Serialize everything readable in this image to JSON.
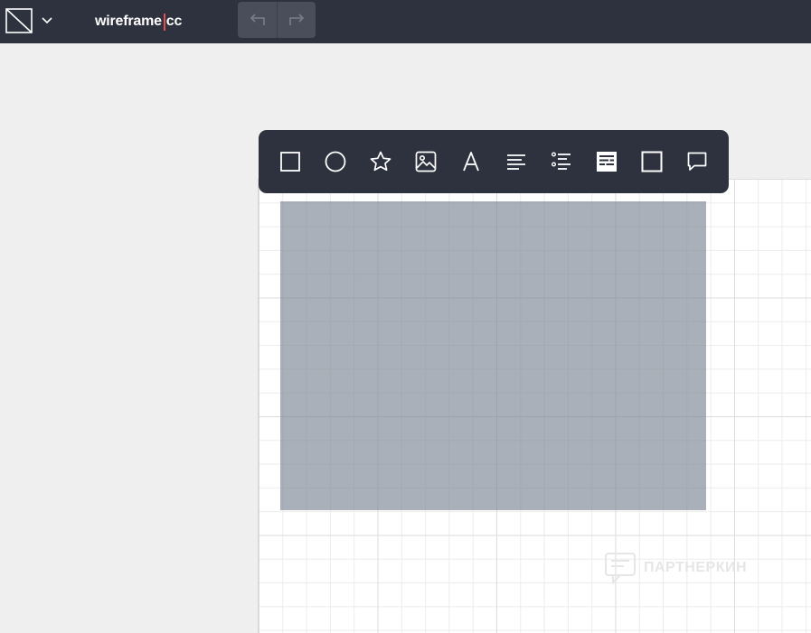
{
  "app": {
    "logo_left": "wireframe",
    "logo_right": "cc",
    "accent_color": "#e0504f"
  },
  "topbar": {
    "background": "#2e323e",
    "doc_menu_icon": "document-outline-icon",
    "doc_menu_chevron": "chevron-down-icon",
    "undo_icon": "undo-arrow-icon",
    "redo_icon": "redo-arrow-icon"
  },
  "toolbar": {
    "tools": [
      {
        "id": "rectangle",
        "icon": "square-outline-icon"
      },
      {
        "id": "ellipse",
        "icon": "circle-outline-icon"
      },
      {
        "id": "icon",
        "icon": "star-outline-icon"
      },
      {
        "id": "image",
        "icon": "image-icon"
      },
      {
        "id": "text",
        "icon": "letter-a-icon"
      },
      {
        "id": "paragraph",
        "icon": "text-lines-icon"
      },
      {
        "id": "list",
        "icon": "bullet-list-icon"
      },
      {
        "id": "text-block",
        "icon": "filled-block-icon"
      },
      {
        "id": "frame",
        "icon": "frame-square-icon"
      },
      {
        "id": "comment",
        "icon": "speech-bubble-icon"
      }
    ]
  },
  "canvas": {
    "selected_shape_color": "#7c8694"
  },
  "watermark": {
    "text": "ПАРТНЕРКИН",
    "icon": "chat-bubble-logo-icon"
  }
}
